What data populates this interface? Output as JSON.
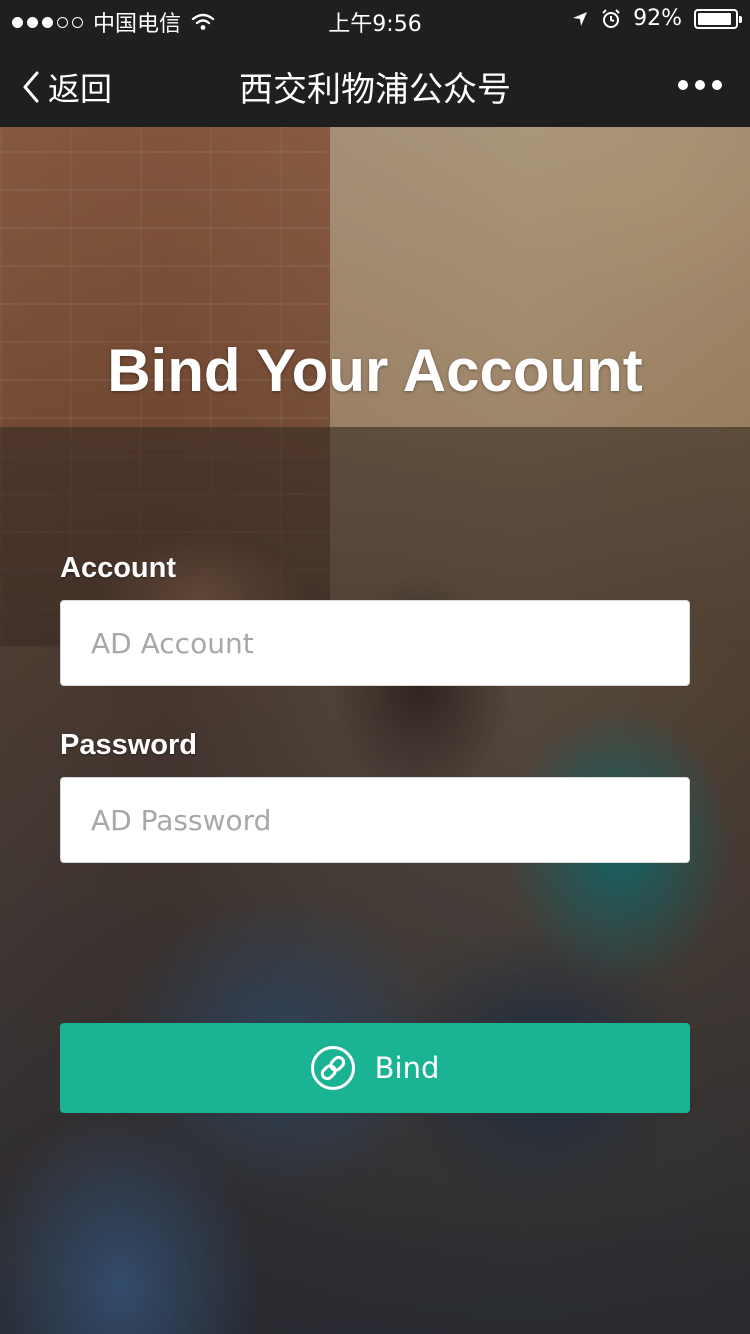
{
  "status_bar": {
    "carrier": "中国电信",
    "time": "上午9:56",
    "battery_percent": "92%",
    "battery_level": 0.92,
    "signal_bars_filled": 3,
    "signal_bars_total": 5,
    "icons": [
      "wifi-icon",
      "location-arrow-icon",
      "alarm-icon",
      "battery-icon"
    ]
  },
  "nav": {
    "back_label": "返回",
    "title": "西交利物浦公众号",
    "more_icon": "more-dots-icon"
  },
  "form": {
    "title": "Bind Your Account",
    "account_label": "Account",
    "account_placeholder": "AD Account",
    "account_value": "",
    "password_label": "Password",
    "password_placeholder": "AD Password",
    "password_value": "",
    "bind_label": "Bind",
    "bind_icon": "link-icon"
  },
  "colors": {
    "bar_background": "#1f1f21",
    "button": "#1ab394",
    "text_light": "#ffffff"
  }
}
